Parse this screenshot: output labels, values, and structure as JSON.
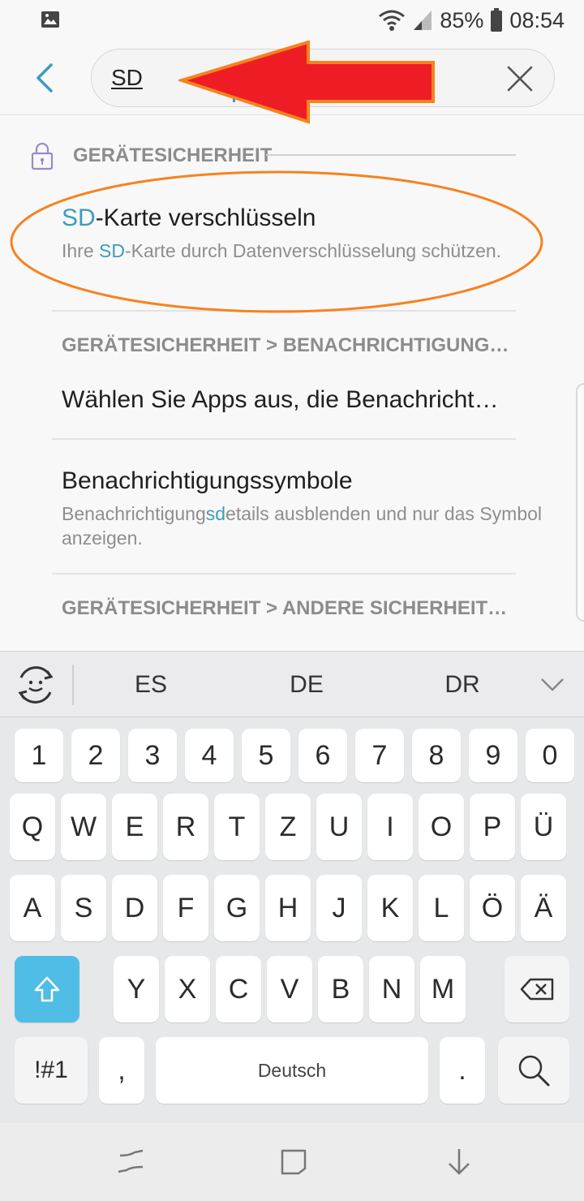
{
  "status_bar": {
    "battery_percent": "85%",
    "time": "08:54",
    "icons": [
      "gallery-icon",
      "wifi-icon",
      "signal-icon",
      "battery-icon"
    ]
  },
  "search": {
    "query": "SD",
    "icons": [
      "back-arrow-icon",
      "clear-x-icon"
    ]
  },
  "results": {
    "section_1": "GERÄTESICHERHEIT",
    "item_1": {
      "title_highlight": "SD",
      "title_rest": "-Karte verschlüsseln",
      "sub_pre": "Ihre ",
      "sub_highlight": "SD",
      "sub_rest": "-Karte durch Datenverschlüsselung schützen."
    },
    "section_2": "GERÄTESICHERHEIT > BENACHRICHTIGUNG…",
    "item_2": {
      "title": "Wählen Sie Apps aus, die Benachricht…"
    },
    "item_3": {
      "title": "Benachrichtigungssymbole",
      "sub_pre": "Benachrichtigung",
      "sub_highlight": "sd",
      "sub_rest": "etails ausblenden und nur das Symbol anzeigen."
    },
    "section_3": "GERÄTESICHERHEIT > ANDERE SICHERHEIT…"
  },
  "keyboard": {
    "suggestions": [
      "ES",
      "DE",
      "DR"
    ],
    "row_numbers": [
      "1",
      "2",
      "3",
      "4",
      "5",
      "6",
      "7",
      "8",
      "9",
      "0"
    ],
    "row_1": [
      "Q",
      "W",
      "E",
      "R",
      "T",
      "Z",
      "U",
      "I",
      "O",
      "P",
      "Ü"
    ],
    "row_2": [
      "A",
      "S",
      "D",
      "F",
      "G",
      "H",
      "J",
      "K",
      "L",
      "Ö",
      "Ä"
    ],
    "row_3": [
      "Y",
      "X",
      "C",
      "V",
      "B",
      "N",
      "M"
    ],
    "symbols_label": "!#1",
    "comma_label": ",",
    "space_label": "Deutsch",
    "period_label": ".",
    "shift_color": "#4fbde5"
  },
  "annotations": {
    "arrow_color": "#ee1c24",
    "arrow_outline_color": "#f7821e",
    "ellipse_color": "#f7821e"
  }
}
